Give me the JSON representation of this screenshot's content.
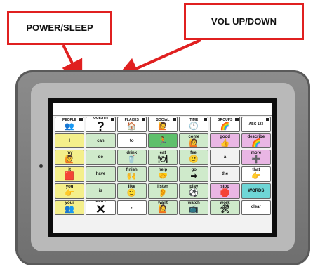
{
  "callouts": {
    "power": "POWER/SLEEP",
    "volume": "VOL UP/DOWN"
  },
  "colors": {
    "callout_border": "#e02020",
    "device_body": "#7d7d7d",
    "bezel": "#b9b9b9"
  },
  "grid": {
    "rows": [
      [
        {
          "label": "PEOPLE",
          "icon": "people-icon",
          "bg": "#ffffff",
          "pic": "👥"
        },
        {
          "label": "QUESTN",
          "icon": "question-icon",
          "bg": "#ffffff",
          "big": "?"
        },
        {
          "label": "PLACES",
          "icon": "places-icon",
          "bg": "#ffffff",
          "pic": "🏠"
        },
        {
          "label": "SOCIAL",
          "icon": "social-icon",
          "bg": "#ffffff",
          "pic": "🙋"
        },
        {
          "label": "TIME",
          "icon": "clock-icon",
          "bg": "#ffffff",
          "pic": "🕒"
        },
        {
          "label": "GROUPS",
          "icon": "groups-icon",
          "bg": "#ffffff",
          "pic": "🌈"
        },
        {
          "label": "ABC\n123",
          "icon": "abc-icon",
          "bg": "#ffffff",
          "word": "ABC 123"
        }
      ],
      [
        {
          "label": "I",
          "bg": "#f4ef8b"
        },
        {
          "label": "can",
          "bg": "#cfeacb"
        },
        {
          "label": "to",
          "bg": "#ffffff"
        },
        {
          "label": "",
          "icon": "action-icon",
          "bg": "#5fbf6c",
          "pic": "🏃"
        },
        {
          "label": "come",
          "icon": "come-icon",
          "bg": "#cfeacb",
          "pic": "🙋"
        },
        {
          "label": "good",
          "icon": "good-icon",
          "bg": "#e9b6e4",
          "pic": "👍"
        },
        {
          "label": "describe",
          "icon": "describe-icon",
          "bg": "#e9b6e4",
          "pic": "🌈"
        }
      ],
      [
        {
          "label": "my",
          "icon": "my-icon",
          "bg": "#f4ef8b",
          "pic": "🙋"
        },
        {
          "label": "do",
          "bg": "#cfeacb"
        },
        {
          "label": "drink",
          "icon": "drink-icon",
          "bg": "#cfeacb",
          "pic": "🥤"
        },
        {
          "label": "eat",
          "icon": "eat-icon",
          "bg": "#cfeacb",
          "pic": "🍽"
        },
        {
          "label": "feel",
          "icon": "feel-icon",
          "bg": "#cfeacb",
          "pic": "🙂"
        },
        {
          "label": "a",
          "bg": "#f2f2f2"
        },
        {
          "label": "more",
          "icon": "more-icon",
          "bg": "#e9b6e4",
          "pic": "➕"
        }
      ],
      [
        {
          "label": "it",
          "icon": "it-icon",
          "bg": "#f4ef8b",
          "pic": "🟥"
        },
        {
          "label": "have",
          "bg": "#cfeacb"
        },
        {
          "label": "finish",
          "icon": "finish-icon",
          "bg": "#cfeacb",
          "pic": "🙌"
        },
        {
          "label": "help",
          "icon": "help-icon",
          "bg": "#cfeacb",
          "pic": "🤝"
        },
        {
          "label": "go",
          "icon": "go-icon",
          "bg": "#cfeacb",
          "pic": "➡"
        },
        {
          "label": "the",
          "bg": "#f2f2f2"
        },
        {
          "label": "that",
          "icon": "that-icon",
          "bg": "#ffffff",
          "pic": "👉"
        }
      ],
      [
        {
          "label": "you",
          "icon": "you-icon",
          "bg": "#f4ef8b",
          "pic": "👉"
        },
        {
          "label": "is",
          "bg": "#cfeacb"
        },
        {
          "label": "like",
          "icon": "like-icon",
          "bg": "#cfeacb",
          "pic": "🙂"
        },
        {
          "label": "listen",
          "icon": "listen-icon",
          "bg": "#cfeacb",
          "pic": "👂"
        },
        {
          "label": "play",
          "icon": "play-icon",
          "bg": "#cfeacb",
          "pic": "⚽"
        },
        {
          "label": "stop",
          "icon": "stop-icon",
          "bg": "#e9b6e4",
          "pic": "🛑"
        },
        {
          "label": "WORDS",
          "icon": "words-icon",
          "bg": "#6fd6d6",
          "word": "WORDS"
        }
      ],
      [
        {
          "label": "your",
          "icon": "your-icon",
          "bg": "#f4ef8b",
          "pic": "👥"
        },
        {
          "label": "don't",
          "icon": "dont-icon",
          "bg": "#ffffff",
          "big": "✕"
        },
        {
          "label": ",",
          "bg": "#ffffff"
        },
        {
          "label": "want",
          "icon": "want-icon",
          "bg": "#cfeacb",
          "pic": "🙋"
        },
        {
          "label": "watch",
          "icon": "watch-icon",
          "bg": "#cfeacb",
          "pic": "📺"
        },
        {
          "label": "work",
          "icon": "work-icon",
          "bg": "#cfeacb",
          "pic": "🛠"
        },
        {
          "label": "clear",
          "bg": "#ffffff"
        }
      ]
    ]
  }
}
